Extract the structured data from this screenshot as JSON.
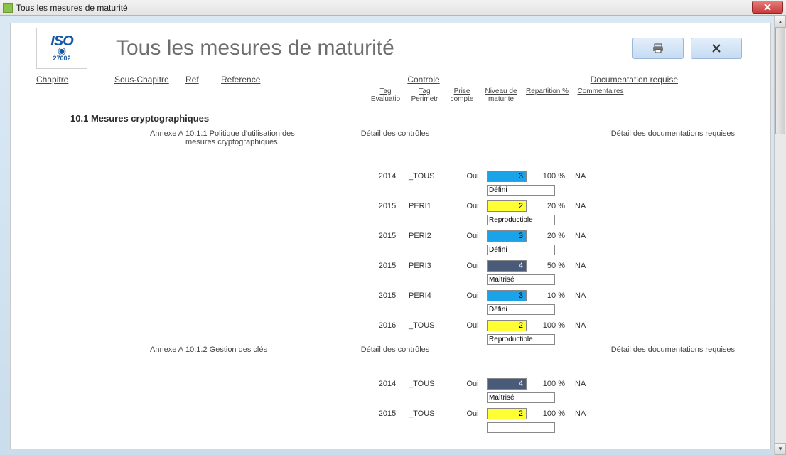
{
  "window_title": "Tous les mesures de maturité",
  "page_title": "Tous les mesures de maturité",
  "logo": {
    "brand": "ISO",
    "sub": "27002"
  },
  "buttons": {
    "print": "print",
    "close": "✕"
  },
  "columns": {
    "chapitre": "Chapitre",
    "sous_chapitre": "Sous-Chapitre",
    "ref": "Ref",
    "reference": "Reference",
    "controle": "Controle",
    "documentation": "Documentation requise"
  },
  "subcolumns": {
    "tag_eval": "Tag Evaluatio",
    "tag_peri": "Tag Perimetr",
    "prise": "Prise compte",
    "niveau": "Niveau de maturite",
    "repartition": "Repartition %",
    "commentaires": "Commentaires"
  },
  "section": {
    "num": "10.1",
    "title": "Mesures cryptographiques"
  },
  "references": [
    {
      "annexe": "Annexe A",
      "ref": "10.1.1 Politique d'utilisation des mesures cryptographiques",
      "detail_ctrl": "Détail des contrôles",
      "detail_doc": "Détail des documentations requises",
      "rows": [
        {
          "tag": "2014",
          "peri": "_TOUS",
          "prise": "Oui",
          "niv": 3,
          "niv_txt": "Défini",
          "rep": "100 %",
          "comm": "NA"
        },
        {
          "tag": "2015",
          "peri": "PERI1",
          "prise": "Oui",
          "niv": 2,
          "niv_txt": "Reproductible",
          "rep": "20 %",
          "comm": "NA"
        },
        {
          "tag": "2015",
          "peri": "PERI2",
          "prise": "Oui",
          "niv": 3,
          "niv_txt": "Défini",
          "rep": "20 %",
          "comm": "NA"
        },
        {
          "tag": "2015",
          "peri": "PERI3",
          "prise": "Oui",
          "niv": 4,
          "niv_txt": "Maîtrisé",
          "rep": "50 %",
          "comm": "NA"
        },
        {
          "tag": "2015",
          "peri": "PERI4",
          "prise": "Oui",
          "niv": 3,
          "niv_txt": "Défini",
          "rep": "10 %",
          "comm": "NA"
        },
        {
          "tag": "2016",
          "peri": "_TOUS",
          "prise": "Oui",
          "niv": 2,
          "niv_txt": "Reproductible",
          "rep": "100 %",
          "comm": "NA"
        }
      ]
    },
    {
      "annexe": "Annexe A",
      "ref": "10.1.2 Gestion des clés",
      "detail_ctrl": "Détail des contrôles",
      "detail_doc": "Détail des documentations requises",
      "rows": [
        {
          "tag": "2014",
          "peri": "_TOUS",
          "prise": "Oui",
          "niv": 4,
          "niv_txt": "Maîtrisé",
          "rep": "100 %",
          "comm": "NA"
        },
        {
          "tag": "2015",
          "peri": "_TOUS",
          "prise": "Oui",
          "niv": 2,
          "niv_txt": "",
          "rep": "100 %",
          "comm": "NA"
        }
      ]
    }
  ]
}
